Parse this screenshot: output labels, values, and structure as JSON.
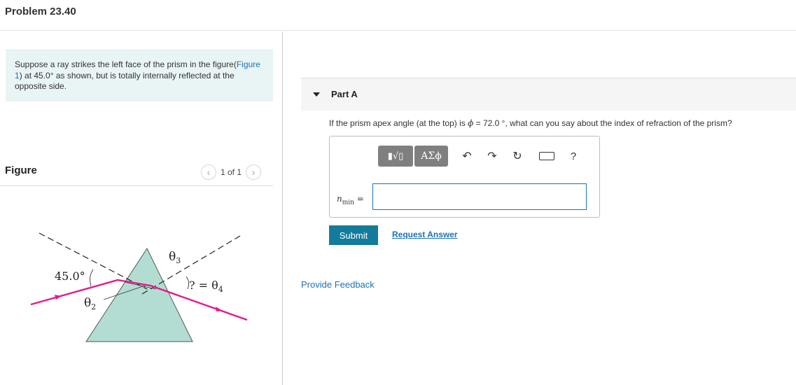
{
  "header": {
    "problem_title": "Problem 23.40"
  },
  "intro": {
    "text_before": "Suppose a ray strikes the left face of the prism in the figure(",
    "figure_link": "Figure 1",
    "text_after": ") at 45.0° as shown, but is totally internally reflected at the opposite side."
  },
  "figure": {
    "label": "Figure",
    "pager_text": "1 of 1",
    "prev_icon": "chevron-left-icon",
    "next_icon": "chevron-right-icon",
    "labels": {
      "angle_incident": "45.0°",
      "theta2": "θ",
      "theta2_sub": "2",
      "theta3": "θ",
      "theta3_sub": "3",
      "theta4_prefix": "? = θ",
      "theta4_sub": "4"
    },
    "colors": {
      "prism": "#b3ddd2",
      "ray": "#e8188c",
      "dashed": "#222222"
    }
  },
  "part": {
    "label": "Part A",
    "question_before": "If the prism apex angle (at the top) is ",
    "question_phi": "ϕ",
    "question_after": " = 72.0 °, what can you say about the index of refraction of the prism?",
    "toolbar": {
      "template_label": "▮√▯",
      "greek_label": "ΑΣϕ",
      "undo_icon": "undo-icon",
      "redo_icon": "redo-icon",
      "reset_icon": "reset-icon",
      "keyboard_icon": "keyboard-icon",
      "help_label": "?"
    },
    "variable_base": "n",
    "variable_sub": "min",
    "equals": " =",
    "answer_value": "",
    "submit_label": "Submit",
    "request_label": "Request Answer"
  },
  "feedback_label": "Provide Feedback"
}
